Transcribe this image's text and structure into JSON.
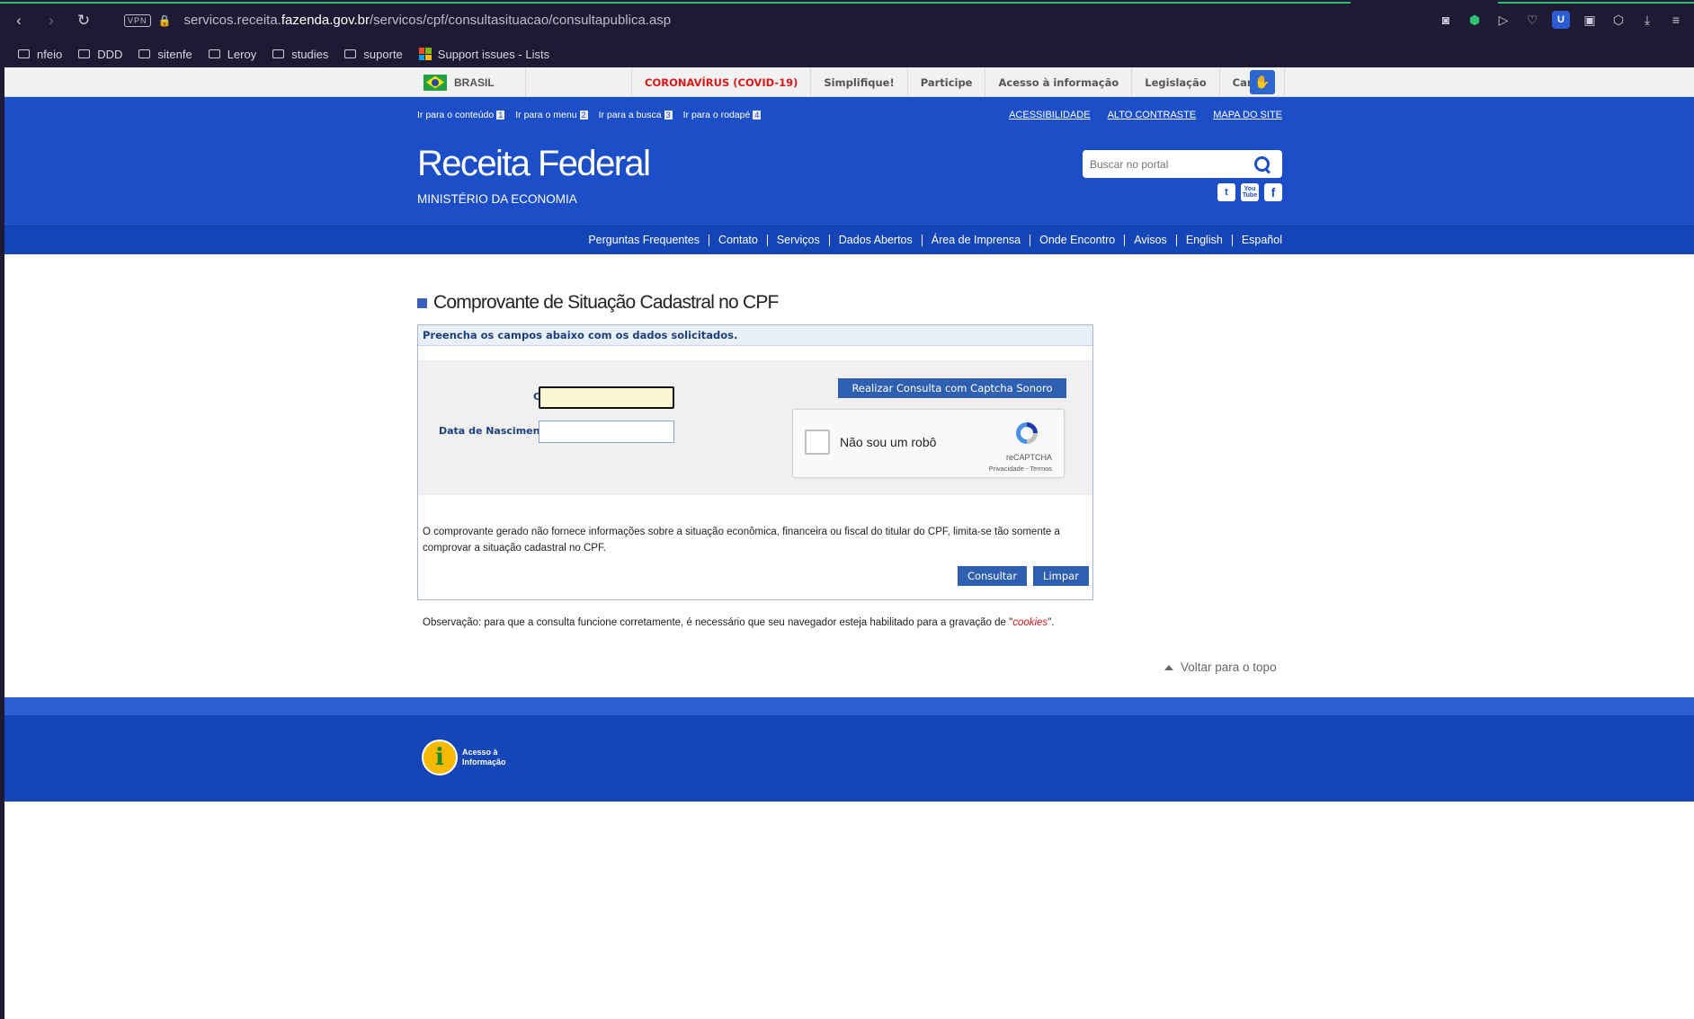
{
  "browser": {
    "url_prefix": "servicos.receita.",
    "url_domain": "fazenda.gov.br",
    "url_path": "/servicos/cpf/consultasituacao/consultapublica.asp",
    "vpn_label": "VPN",
    "bookmarks": [
      "nfeio",
      "DDD",
      "sitenfe",
      "Leroy",
      "studies",
      "suporte",
      "Support issues - Lists"
    ]
  },
  "govbar": {
    "country": "BRASIL",
    "links": [
      "CORONAVÍRUS (COVID-19)",
      "Simplifique!",
      "Participe",
      "Acesso à informação",
      "Legislação",
      "Canais"
    ]
  },
  "header": {
    "skip_links": [
      {
        "label": "Ir para o conteúdo",
        "key": "1"
      },
      {
        "label": "Ir para o menu",
        "key": "2"
      },
      {
        "label": "Ir para a busca",
        "key": "3"
      },
      {
        "label": "Ir para o rodapé",
        "key": "4"
      }
    ],
    "accessibility_links": [
      "ACESSIBILIDADE",
      "ALTO CONTRASTE",
      "MAPA DO SITE"
    ],
    "brand": "Receita Federal",
    "ministry": "MINISTÉRIO DA ECONOMIA",
    "search_placeholder": "Buscar no portal",
    "social": [
      "t",
      "You Tube",
      "f"
    ]
  },
  "menu": [
    "Perguntas Frequentes",
    "Contato",
    "Serviços",
    "Dados Abertos",
    "Área de Imprensa",
    "Onde Encontro",
    "Avisos",
    "English",
    "Español"
  ],
  "form": {
    "title": "Comprovante de Situação Cadastral no CPF",
    "instruction": "Preencha os campos abaixo com os dados solicitados.",
    "cpf_label": "CPF:",
    "birth_label": "Data de Nascimento:",
    "audio_captcha_button": "Realizar Consulta com Captcha Sonoro",
    "recaptcha": {
      "text": "Não sou um robô",
      "brand": "reCAPTCHA",
      "terms": "Privacidade - Termos"
    },
    "disclaimer": "O comprovante gerado não fornece informações sobre a situação econômica, financeira ou fiscal do titular do CPF, limita-se tão somente a comprovar a situação cadastral no CPF.",
    "submit_button": "Consultar",
    "clear_button": "Limpar"
  },
  "observation": {
    "before": "Observação: para que a consulta funcione corretamente, é necessário que seu navegador esteja habilitado para a gravação de \"",
    "cookies": "cookies",
    "after": "\"."
  },
  "back_to_top": "Voltar para o topo",
  "footer": {
    "logo_letter": "i",
    "logo_text": "Acesso à Informação"
  }
}
